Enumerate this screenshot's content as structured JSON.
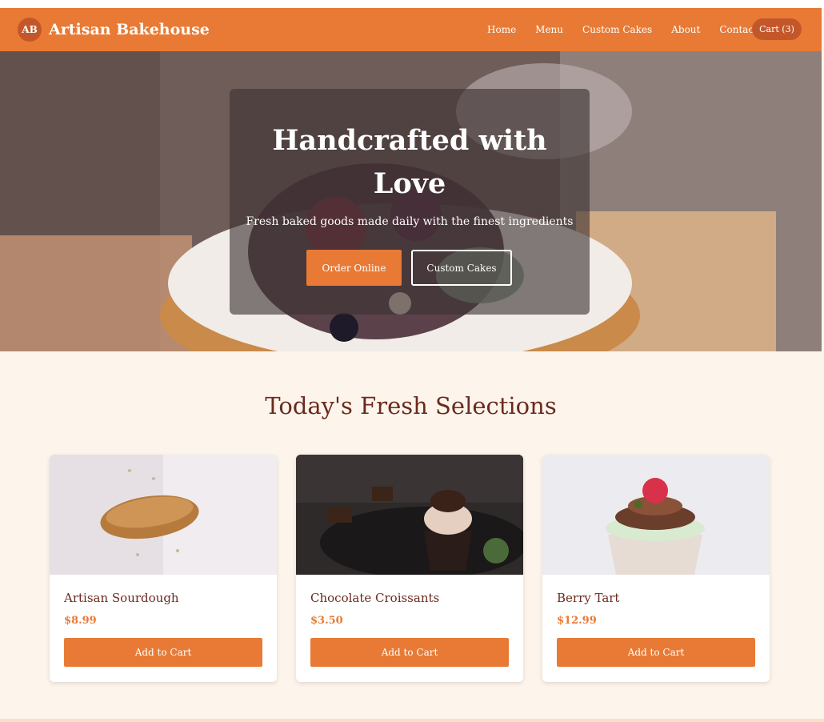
{
  "brand": {
    "logo_initials": "AB",
    "name": "Artisan Bakehouse"
  },
  "nav": {
    "items": [
      "Home",
      "Menu",
      "Custom Cakes",
      "About",
      "Contact"
    ],
    "cart_label": "Cart (3)"
  },
  "hero": {
    "title": "Handcrafted with Love",
    "subtitle": "Fresh baked goods made daily with the finest ingredients",
    "primary_button": "Order Online",
    "secondary_button": "Custom Cakes"
  },
  "section": {
    "title": "Today's Fresh Selections"
  },
  "products": [
    {
      "name": "Artisan Sourdough",
      "price": "$8.99",
      "button": "Add to Cart"
    },
    {
      "name": "Chocolate Croissants",
      "price": "$3.50",
      "button": "Add to Cart"
    },
    {
      "name": "Berry Tart",
      "price": "$12.99",
      "button": "Add to Cart"
    }
  ],
  "colors": {
    "accent": "#e87a35",
    "accent_dark": "#c4572a",
    "heading": "#6b2a1e",
    "page_bg": "#fdf5eb"
  }
}
